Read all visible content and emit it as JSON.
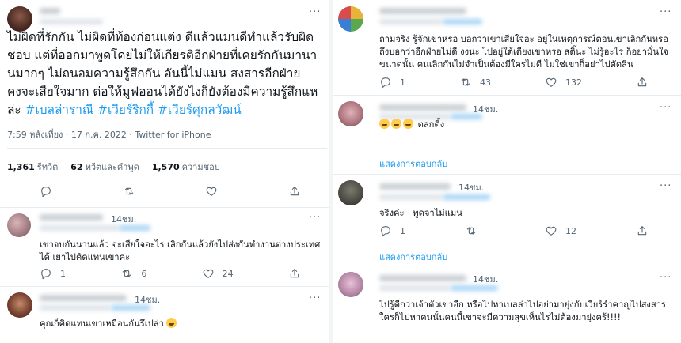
{
  "main_tweet": {
    "text": "ไม่ผิดที่รักกัน ไม่ผิดที่ท้องก่อนแต่ง ดีแล้วแมนดีทำแล้วรับผิดชอบ แต่ที่ออกมาพูดโดยไม่ให้เกียรติอีกฝ่ายที่เคยรักกันมานานมากๆ ไม่ถนอมความรู้สึกกัน อันนี้ไม่แมน สงสารอีกฝ่ายคงจะเสียใจมาก ต่อให้มูฟออนได้ยังไงก็ยังต้องมีความรู้สึกแหล่ะ ",
    "hashtags": [
      "#เบลล่าราณี",
      "#เวียร์ริกกี้",
      "#เวียร์ศุกลวัฒน์"
    ],
    "meta": "7:59 หลังเที่ยง · 17 ก.ค. 2022 · Twitter for iPhone",
    "stats": {
      "retweets_count": "1,361",
      "retweets_label": "รีทวีต",
      "quotes_count": "62",
      "quotes_label": "ทวีตและคำพูด",
      "likes_count": "1,570",
      "likes_label": "ความชอบ"
    },
    "more": "···"
  },
  "left_replies": [
    {
      "time": "14ชม.",
      "text": "เขาจบกันนานแล้ว จะเสียใจอะไร เลิกกันแล้วยังไปส่งกันทำงานต่างประเทศได้ เยาไปคิดแทนเขาค่ะ",
      "replies": "1",
      "retweets": "6",
      "likes": "24",
      "more": "···"
    },
    {
      "time": "14ชม.",
      "text": "คุณก็คิดแทนเขาเหมือนกันรึเปล่า",
      "more": "···"
    }
  ],
  "right_replies": [
    {
      "text": "ถามจริง รู้จักเขาหรอ บอกว่าเขาเสียใจอะ อยู่ในเหตุการณ์ตอนเขาเลิกกันหรอ ถึงบอกว่าอีกฝ่ายไม่ดี งงนะ ไปอยู่ใต้เตียงเขาหรอ สติ๊นะ ไม่รู้อะไร ก็อย่ามั่นใจขนาดนั้น คนเลิกกันไม่จำเป็นต้องมีใครไม่ดี ไม่ใช่เขาก็อย่าไปตัดสิน",
      "replies": "1",
      "retweets": "43",
      "likes": "132",
      "more": "···"
    },
    {
      "time": "14ชม.",
      "text": "ตลกดิ้ง",
      "show_replies": "แสดงการตอบกลับ",
      "more": "···"
    },
    {
      "time": "14ชม.",
      "text": "จริงค่ะ   พูดจาไม่แมน",
      "replies": "1",
      "retweets": "",
      "likes": "12",
      "show_replies": "แสดงการตอบกลับ",
      "more": "···"
    },
    {
      "time": "14ชม.",
      "text": "ไปรู้ดีกว่าเจ้าตัวเขาอีก หรือไปหาเบลล่าไปอย่ามายุ่งกับเวียร์รำคาญไปสงสารใครก็ไปหาคนนั้นคนนี้เขาจะมีความสุขเห็นไรไม่ต้องมายุ่งคร้!!!!",
      "more": "···"
    }
  ],
  "icons": {
    "reply": "reply-icon",
    "retweet": "retweet-icon",
    "like": "heart-icon",
    "share": "share-icon"
  }
}
